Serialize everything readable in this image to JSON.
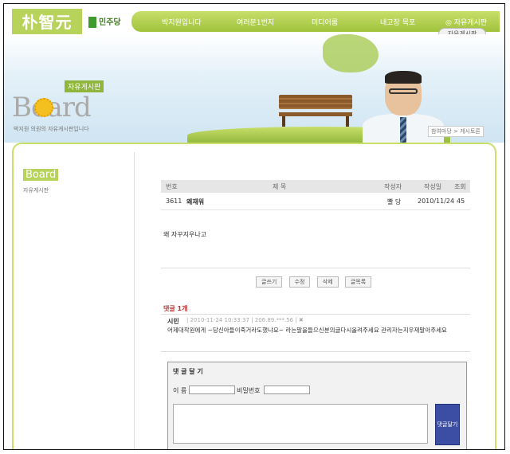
{
  "header": {
    "logo": "朴智元",
    "party": "민주당",
    "nav": [
      "박지원입니다",
      "여러분1번지",
      "미디어룸",
      "내고장 목포",
      "◎ 자유게시판"
    ],
    "subtab": "자유게시판"
  },
  "banner": {
    "tag": "자유게시판",
    "title": "Board",
    "desc": "박지원 의원의 자유게시판입니다",
    "breadcrumb": "참여마당 > 게시토론"
  },
  "sidebar": {
    "title": "Board",
    "item": "자유게시판"
  },
  "table": {
    "headers": [
      "번호",
      "제 목",
      "작성자",
      "작성일",
      "조회"
    ],
    "row": {
      "no": "3611",
      "title": "왜재워",
      "author": "빨 당",
      "date": "2010/11/24",
      "views": "45"
    }
  },
  "post": {
    "body": "왜 자꾸지우나고"
  },
  "buttons": [
    "글쓰기",
    "수정",
    "삭제",
    "글목록"
  ],
  "comments": {
    "count_label": "댓글 1개",
    "items": [
      {
        "author": "시민",
        "meta": "| 2010-11-24 10:33:37 | 206.89.***.56 | ✖",
        "text": "어제대작원에게 ~당신아들이죽거라도했냐요~ 라는말을들으신분의글다시올려주세요 관리자는지우재말아주세요"
      }
    ]
  },
  "comment_form": {
    "title": "댓 글 달 기",
    "name_label": "이 름",
    "password_label": "비밀번호",
    "submit_label": "댓글달기"
  }
}
